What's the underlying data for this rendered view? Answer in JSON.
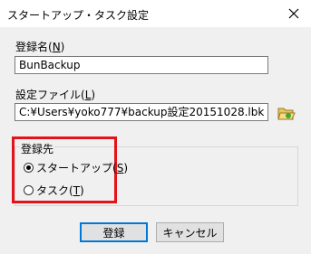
{
  "window": {
    "title": "スタートアップ・タスク設定"
  },
  "reg_name": {
    "label_pre": "登録名(",
    "accel": "N",
    "label_post": ")",
    "value": "BunBackup"
  },
  "settings_file": {
    "label_pre": "設定ファイル(",
    "accel": "L",
    "label_post": ")",
    "value": "C:¥Users¥yoko777¥backup設定20151028.lbk"
  },
  "destination": {
    "title": "登録先",
    "options": [
      {
        "label_pre": "スタートアップ(",
        "accel": "S",
        "label_post": ")",
        "checked": true
      },
      {
        "label_pre": "タスク(",
        "accel": "T",
        "label_post": ")",
        "checked": false
      }
    ]
  },
  "buttons": {
    "register": "登録",
    "cancel": "キャンセル"
  },
  "colors": {
    "highlight_box": "#e4131b",
    "default_button_border": "#0078d7",
    "dialog_bg": "#f0f0f0"
  }
}
